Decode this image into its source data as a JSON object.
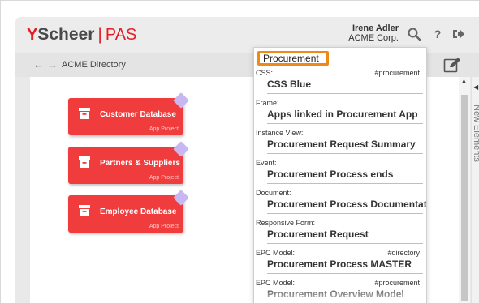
{
  "app": {
    "logo_mark": "Y",
    "logo_name": "Scheer",
    "logo_separator": "|",
    "logo_product": "PAS"
  },
  "user": {
    "name": "Irene Adler",
    "company": "ACME Corp."
  },
  "header_icons": [
    "search-icon",
    "help-icon",
    "logout-icon"
  ],
  "help_glyph": "?",
  "breadcrumb": "ACME Directory",
  "nav": {
    "back": "←",
    "forward": "→"
  },
  "side_panel": {
    "label": "New Elements"
  },
  "cards": [
    {
      "label": "Customer Database",
      "type": "App Project"
    },
    {
      "label": "Partners & Suppliers",
      "type": "App Project"
    },
    {
      "label": "Employee Database",
      "type": "App Project"
    }
  ],
  "search": {
    "value": "Procurement"
  },
  "results": [
    {
      "type": "CSS:",
      "tag": "#procurement",
      "name": "CSS Blue"
    },
    {
      "type": "Frame:",
      "tag": "",
      "name": "Apps linked in Procurement App"
    },
    {
      "type": "Instance View:",
      "tag": "",
      "name": "Procurement Request Summary"
    },
    {
      "type": "Event:",
      "tag": "",
      "name": "Procurement Process ends"
    },
    {
      "type": "Document:",
      "tag": "",
      "name": "Procurement Process Documentation"
    },
    {
      "type": "Responsive Form:",
      "tag": "",
      "name": "Procurement Request"
    },
    {
      "type": "EPC Model:",
      "tag": "#directory",
      "name": "Procurement Process MASTER"
    },
    {
      "type": "EPC Model:",
      "tag": "#procurement",
      "name": "Procurement Overview Model"
    }
  ],
  "colors": {
    "brand_red": "#e41e26",
    "card_red": "#f03c3c",
    "tag_purple": "#c8b7f0",
    "search_highlight": "#ee8a17"
  }
}
